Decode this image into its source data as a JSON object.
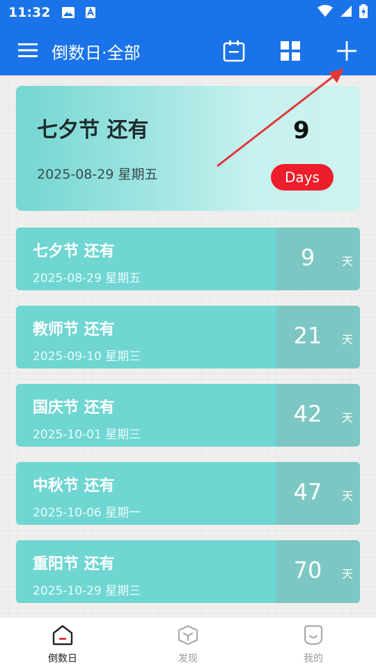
{
  "status_bar": {
    "time": "11:32"
  },
  "toolbar": {
    "title": "倒数日·全部",
    "icons": [
      "menu-icon",
      "calendar-icon",
      "grid-icon",
      "plus-icon"
    ]
  },
  "hero": {
    "title": "七夕节 还有",
    "date": "2025-08-29 星期五",
    "days": "9",
    "badge": "Days"
  },
  "events": [
    {
      "title": "七夕节 还有",
      "date": "2025-08-29  星期五",
      "days": "9",
      "unit": "天"
    },
    {
      "title": "教师节 还有",
      "date": "2025-09-10  星期三",
      "days": "21",
      "unit": "天"
    },
    {
      "title": "国庆节 还有",
      "date": "2025-10-01  星期三",
      "days": "42",
      "unit": "天"
    },
    {
      "title": "中秋节 还有",
      "date": "2025-10-06  星期一",
      "days": "47",
      "unit": "天"
    },
    {
      "title": "重阳节 还有",
      "date": "2025-10-29  星期三",
      "days": "70",
      "unit": "天"
    }
  ],
  "bottom_nav": [
    {
      "label": "倒数日",
      "icon": "home-icon",
      "active": true
    },
    {
      "label": "发现",
      "icon": "cube-icon",
      "active": false
    },
    {
      "label": "我的",
      "icon": "smile-icon",
      "active": false
    }
  ],
  "colors": {
    "primary": "#1a73e8",
    "card": "#6fd6d2",
    "card_right": "#7cc7c3",
    "badge": "#ee1d2b",
    "arrow": "#e03a3a"
  }
}
